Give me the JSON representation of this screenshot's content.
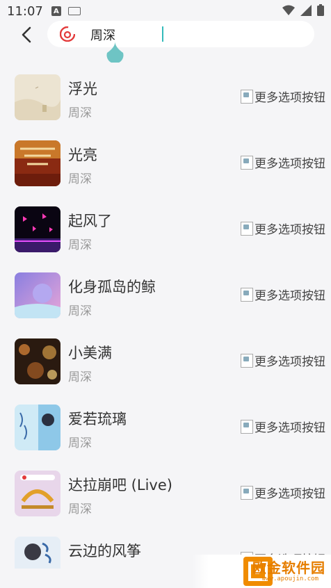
{
  "status_bar": {
    "time": "11:07",
    "notif_a": "A"
  },
  "search": {
    "query": "周深"
  },
  "songs": [
    {
      "title": "浮光",
      "artist": "周深",
      "more": "更多选项按钮"
    },
    {
      "title": "光亮",
      "artist": "周深",
      "more": "更多选项按钮"
    },
    {
      "title": "起风了",
      "artist": "周深",
      "more": "更多选项按钮"
    },
    {
      "title": "化身孤岛的鲸",
      "artist": "周深",
      "more": "更多选项按钮"
    },
    {
      "title": "小美满",
      "artist": "周深",
      "more": "更多选项按钮"
    },
    {
      "title": "爱若琉璃",
      "artist": "周深",
      "more": "更多选项按钮"
    },
    {
      "title": "达拉崩吧 (Live)",
      "artist": "周深",
      "more": "更多选项按钮"
    },
    {
      "title": "云边的风筝",
      "artist": "",
      "more": "更多选项按钮"
    }
  ],
  "watermark": {
    "text": "欧金软件园",
    "sub": "www.apoujin.com"
  },
  "colors": {
    "accent": "#e33b3b",
    "caret": "#5bbcbc",
    "watermark": "#f08c00"
  }
}
